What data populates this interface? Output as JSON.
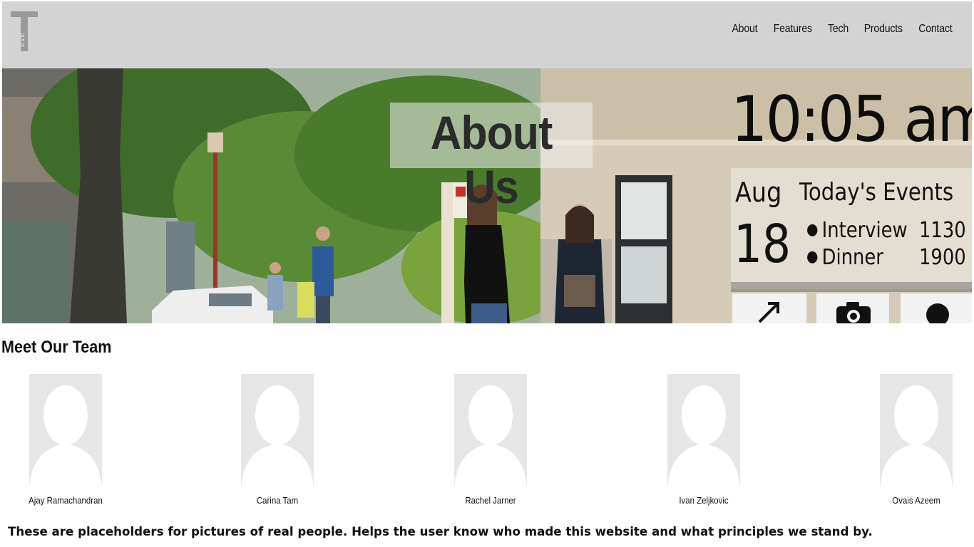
{
  "header": {
    "logo_text": "EVE",
    "nav": [
      "About",
      "Features",
      "Tech",
      "Products",
      "Contact"
    ]
  },
  "hero": {
    "title": "About Us",
    "mirror": {
      "time": "10:05 am",
      "month": "Aug",
      "day": "18",
      "events_title": "Today's Events",
      "events": [
        {
          "name": "Interview",
          "time": "1130"
        },
        {
          "name": "Dinner",
          "time": "1900"
        }
      ],
      "icons": [
        "expand-arrow-icon",
        "camera-icon",
        "user-icon"
      ]
    }
  },
  "team": {
    "heading": "Meet Our Team",
    "members": [
      {
        "name": "Ajay Ramachandran"
      },
      {
        "name": "Carina Tam"
      },
      {
        "name": "Rachel Jarner"
      },
      {
        "name": "Ivan Zeljkovic"
      },
      {
        "name": "Ovais Azeem"
      }
    ]
  },
  "note": "These are placeholders for pictures of real people. Helps the user know who made this website and  what principles  we stand by.",
  "colors": {
    "header_bg": "#d3d3d3",
    "avatar_bg": "#e6e6e6",
    "text": "#111111"
  }
}
